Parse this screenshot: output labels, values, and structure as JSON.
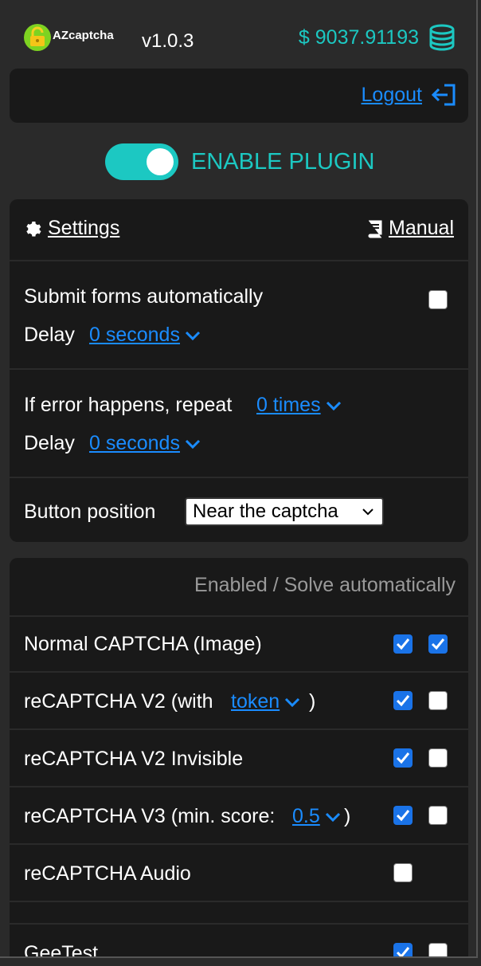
{
  "header": {
    "app_name": "AZcaptcha",
    "version": "v1.0.3",
    "balance": "$ 9037.91193"
  },
  "account": {
    "logout_label": "Logout"
  },
  "plugin": {
    "toggle_label": "ENABLE PLUGIN",
    "enabled": true
  },
  "settings": {
    "settings_label": "Settings",
    "manual_label": "Manual",
    "submit_forms_label": "Submit forms automatically",
    "submit_forms_checked": false,
    "delay_label": "Delay",
    "submit_delay_value": "0 seconds",
    "error_repeat_label": "If error happens, repeat",
    "error_repeat_value": "0 times",
    "error_delay_label": "Delay",
    "error_delay_value": "0 seconds",
    "button_position_label": "Button position",
    "button_position_value": "Near the captcha"
  },
  "captcha_types": {
    "header": "Enabled / Solve automatically",
    "items": [
      {
        "label": "Normal CAPTCHA (Image)",
        "enabled": true,
        "auto": true
      },
      {
        "label": "reCAPTCHA V2 (with",
        "dropdown": "token",
        "suffix": ")",
        "enabled": true,
        "auto": false
      },
      {
        "label": "reCAPTCHA V2 Invisible",
        "enabled": true,
        "auto": false
      },
      {
        "label": "reCAPTCHA V3 (min. score:",
        "dropdown": "0.5",
        "suffix": ")",
        "enabled": true,
        "auto": false
      },
      {
        "label": "reCAPTCHA Audio",
        "enabled": false
      },
      {
        "label": "GeeTest",
        "enabled": true,
        "auto": false
      }
    ]
  },
  "colors": {
    "accent": "#1cc8c2",
    "link": "#1a8cff",
    "checkbox": "#1a73e8",
    "panel": "#191919",
    "background": "#2a2a2a"
  }
}
